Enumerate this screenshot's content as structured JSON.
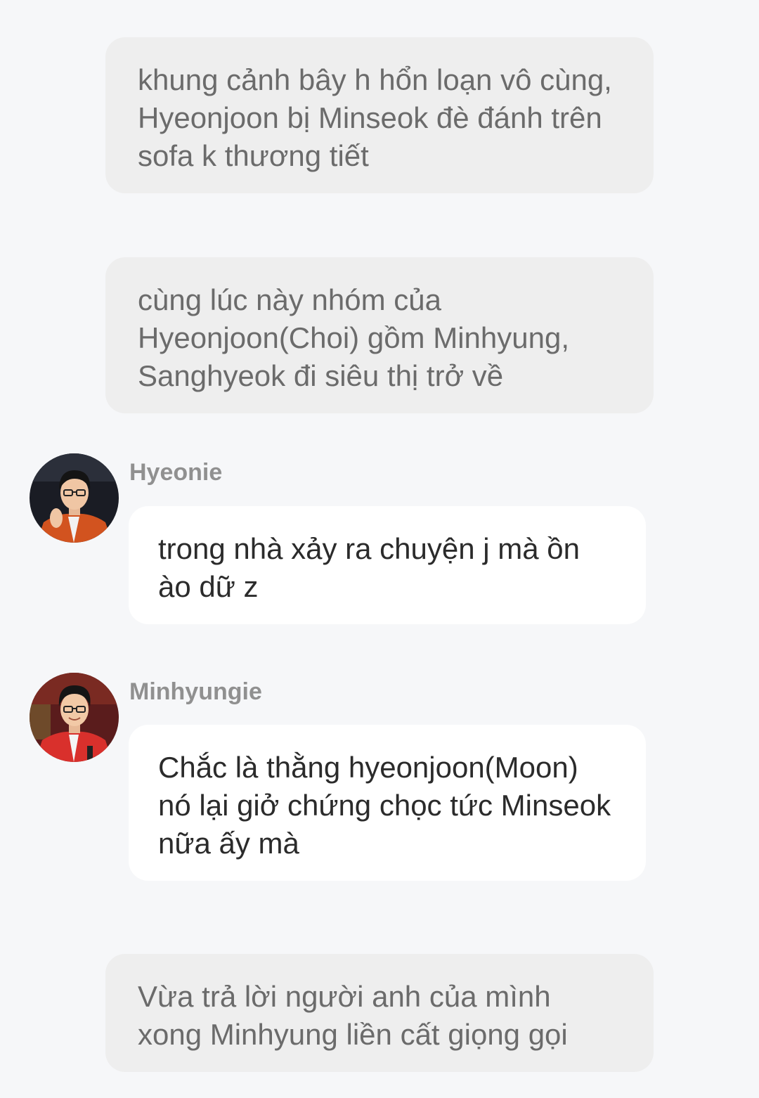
{
  "colors": {
    "background": "#f6f7f9",
    "narration_bubble": "#eeeeee",
    "narration_text": "#6b6b6b",
    "chat_bubble": "#ffffff",
    "chat_text": "#2b2b2b",
    "sender_name": "#909090"
  },
  "messages": [
    {
      "type": "narration",
      "text": "khung cảnh bây h hổn loạn vô cùng, Hyeonjoon bị Minseok đè đánh trên sofa k thương tiết"
    },
    {
      "type": "narration",
      "text": "cùng lúc này nhóm của Hyeonjoon(Choi) gồm Minhyung, Sanghyeok đi siêu thị trở về"
    },
    {
      "type": "chat",
      "sender": "Hyeonie",
      "avatar_icon": "user-avatar-hyeonie",
      "text": "trong nhà xảy ra chuyện j mà ồn ào dữ z"
    },
    {
      "type": "chat",
      "sender": "Minhyungie",
      "avatar_icon": "user-avatar-minhyungie",
      "text": "Chắc là thằng hyeonjoon(Moon) nó lại giở chứng chọc tức Minseok nữa ấy mà"
    },
    {
      "type": "narration",
      "text": "Vừa trả lời người anh của mình xong Minhyung liền cất giọng gọi"
    }
  ]
}
